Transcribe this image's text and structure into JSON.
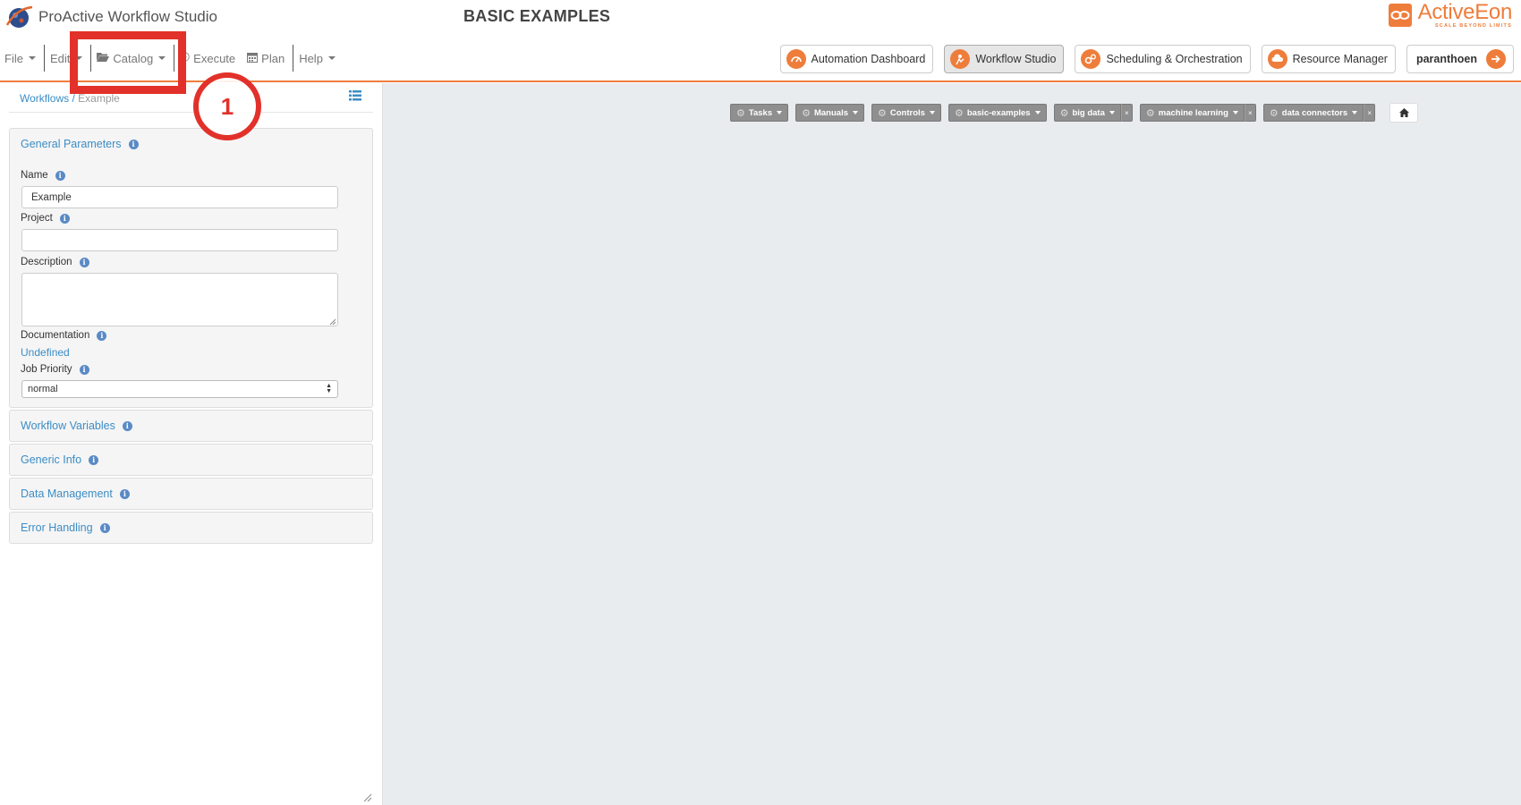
{
  "app": {
    "name": "ProActive Workflow Studio",
    "page_title": "BASIC EXAMPLES",
    "brand_word": "ActiveEon",
    "brand_tagline": "SCALE BEYOND LIMITS"
  },
  "menu": {
    "file": "File",
    "edit": "Edit",
    "catalog": "Catalog",
    "execute": "Execute",
    "plan": "Plan",
    "help": "Help"
  },
  "annotation": {
    "callout_number": "1"
  },
  "portals": {
    "automation": "Automation Dashboard",
    "studio": "Workflow Studio",
    "scheduling": "Scheduling & Orchestration",
    "resources": "Resource Manager",
    "user": "paranthoen"
  },
  "breadcrumb": {
    "root": "Workflows",
    "current": "Example"
  },
  "general": {
    "title": "General Parameters",
    "name_label": "Name",
    "name_value": "Example",
    "project_label": "Project",
    "project_value": "",
    "description_label": "Description",
    "documentation_label": "Documentation",
    "documentation_value": "Undefined",
    "priority_label": "Job Priority",
    "priority_value": "normal"
  },
  "sections": {
    "variables": "Workflow Variables",
    "generic_info": "Generic Info",
    "data_management": "Data Management",
    "error_handling": "Error Handling"
  },
  "palette": {
    "tasks": "Tasks",
    "manuals": "Manuals",
    "controls": "Controls",
    "basic_examples": "basic-examples",
    "big_data": "big data",
    "machine_learning": "machine learning",
    "data_connectors": "data connectors",
    "close_glyph": "×"
  },
  "colors": {
    "accent": "#ee7d3b",
    "link": "#3c8dc5",
    "annotation": "#e2312a",
    "canvas": "#e9ecef"
  }
}
